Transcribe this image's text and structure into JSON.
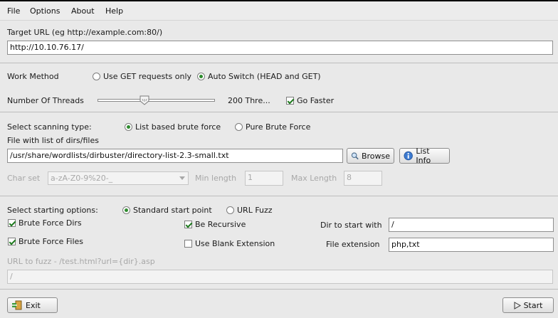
{
  "menu": {
    "file": "File",
    "options": "Options",
    "about": "About",
    "help": "Help"
  },
  "target": {
    "label": "Target URL (eg http://example.com:80/)",
    "value": "http://10.10.76.17/"
  },
  "work_method": {
    "label": "Work Method",
    "opt_get": "Use GET requests only",
    "opt_auto": "Auto Switch (HEAD and GET)",
    "selected": "auto"
  },
  "threads": {
    "label": "Number Of Threads",
    "value": 200,
    "max": 500,
    "display": "200 Thre...",
    "go_faster": "Go Faster",
    "go_faster_checked": true
  },
  "scan": {
    "label": "Select scanning type:",
    "opt_list": "List based brute force",
    "opt_pure": "Pure Brute Force",
    "selected": "list",
    "file_label": "File with list of dirs/files",
    "file_value": "/usr/share/wordlists/dirbuster/directory-list-2.3-small.txt",
    "browse": "Browse",
    "list_info": "List Info",
    "charset_label": "Char set",
    "charset_value": "a-zA-Z0-9%20-_",
    "min_label": "Min length",
    "min_value": "1",
    "max_label": "Max Length",
    "max_value": "8"
  },
  "start_opts": {
    "label": "Select starting options:",
    "opt_standard": "Standard start point",
    "opt_fuzz": "URL Fuzz",
    "selected": "standard",
    "bf_dirs": "Brute Force Dirs",
    "bf_files": "Brute Force Files",
    "recursive": "Be Recursive",
    "blank_ext": "Use Blank Extension",
    "dir_label": "Dir to start with",
    "dir_value": "/",
    "ext_label": "File extension",
    "ext_value": "php,txt",
    "fuzz_label": "URL to fuzz - /test.html?url={dir}.asp",
    "fuzz_value": "/"
  },
  "footer": {
    "exit": "Exit",
    "start": "Start"
  },
  "colors": {
    "background": "#e9e9e9",
    "accent": "#2e8b2e"
  }
}
